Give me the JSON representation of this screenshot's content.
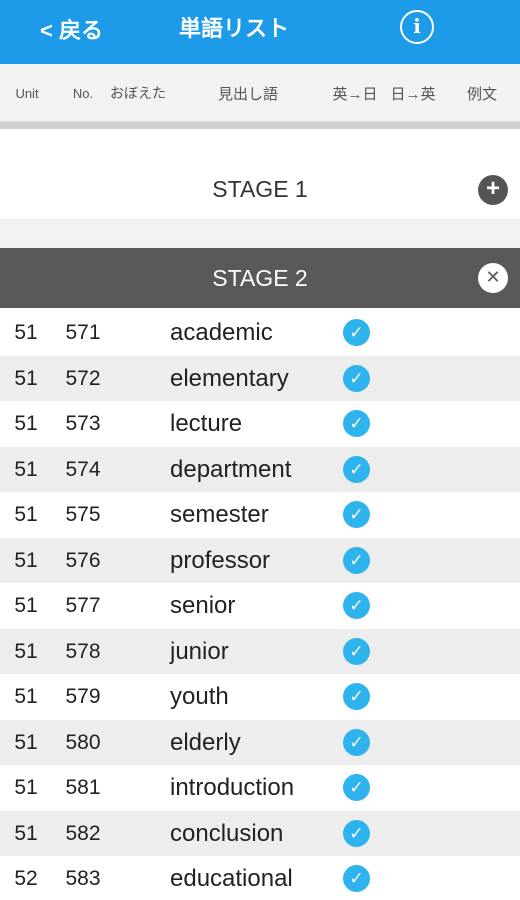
{
  "nav": {
    "back_label": "< 戻る",
    "title": "単語リスト",
    "info_icon": "info-circle-icon",
    "bg_color": "#1e9be8"
  },
  "columns": {
    "unit": "Unit",
    "no": "No.",
    "memorized": "おぼえた",
    "headword": "見出し語",
    "en_to_ja": "英→日",
    "ja_to_en": "日→英",
    "example": "例文"
  },
  "stages": [
    {
      "label": "STAGE 1",
      "state": "collapsed",
      "icon": "plus-circle-icon"
    },
    {
      "label": "STAGE 2",
      "state": "expanded",
      "icon": "close-circle-icon"
    }
  ],
  "check_color": "#2fb3ec",
  "words": [
    {
      "unit": "51",
      "no": "571",
      "word": "academic",
      "memorized": true
    },
    {
      "unit": "51",
      "no": "572",
      "word": "elementary",
      "memorized": true
    },
    {
      "unit": "51",
      "no": "573",
      "word": "lecture",
      "memorized": true
    },
    {
      "unit": "51",
      "no": "574",
      "word": "department",
      "memorized": true
    },
    {
      "unit": "51",
      "no": "575",
      "word": "semester",
      "memorized": true
    },
    {
      "unit": "51",
      "no": "576",
      "word": "professor",
      "memorized": true
    },
    {
      "unit": "51",
      "no": "577",
      "word": "senior",
      "memorized": true
    },
    {
      "unit": "51",
      "no": "578",
      "word": "junior",
      "memorized": true
    },
    {
      "unit": "51",
      "no": "579",
      "word": "youth",
      "memorized": true
    },
    {
      "unit": "51",
      "no": "580",
      "word": "elderly",
      "memorized": true
    },
    {
      "unit": "51",
      "no": "581",
      "word": "introduction",
      "memorized": true
    },
    {
      "unit": "51",
      "no": "582",
      "word": "conclusion",
      "memorized": true
    },
    {
      "unit": "52",
      "no": "583",
      "word": "educational",
      "memorized": true
    }
  ]
}
